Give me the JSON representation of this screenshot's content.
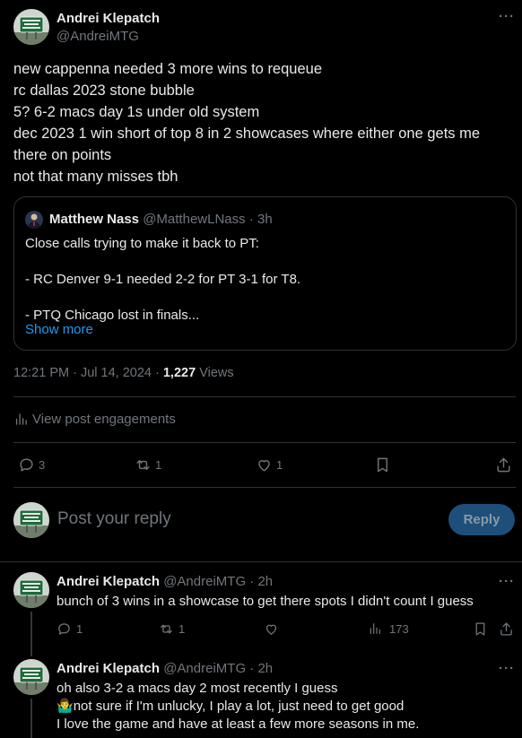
{
  "post": {
    "author_name": "Andrei Klepatch",
    "author_handle": "@AndreiMTG",
    "lines": [
      "new cappenna needed 3 more wins to requeue",
      "rc dallas 2023 stone bubble",
      "5? 6-2 macs day 1s under old system",
      "dec 2023 1 win short of top 8 in 2 showcases where either one gets me",
      "there on points",
      "not that many misses tbh"
    ],
    "quote": {
      "author_name": "Matthew Nass",
      "author_handle": "@MatthewLNass",
      "time": "· 3h",
      "lines": [
        "Close calls trying to make it back to PT:",
        "",
        "- RC Denver 9-1 needed 2-2 for PT 3-1 for T8.",
        "",
        "- PTQ Chicago lost in finals..."
      ],
      "show_more": "Show more"
    },
    "time": "12:21 PM · Jul 14, 2024 ·",
    "views_count": "1,227",
    "views_label": "Views",
    "engagements_label": "View post engagements",
    "replies": "3",
    "reposts": "1",
    "likes": "1"
  },
  "reply_box": {
    "placeholder": "Post your reply",
    "button": "Reply"
  },
  "replies": [
    {
      "author_name": "Andrei Klepatch",
      "author_handle": "@AndreiMTG",
      "time": "· 2h",
      "lines": [
        "bunch of 3 wins in a showcase to get there spots I didn't count I guess"
      ],
      "replies": "1",
      "reposts": "1",
      "views": "173"
    },
    {
      "author_name": "Andrei Klepatch",
      "author_handle": "@AndreiMTG",
      "time": "· 2h",
      "lines": [
        "oh also 3-2 a macs day 2 most recently I guess",
        "not sure if I'm unlucky, I play a lot, just need to get good",
        "I love the game and have at least a few more seasons in me."
      ],
      "emoji": "🤷‍♂️"
    }
  ],
  "colors": {
    "background": "#000000",
    "text": "#e7e9ea",
    "muted": "#71767b",
    "accent": "#1d9bf0",
    "divider": "#2f3336"
  },
  "icons": [
    "reply-icon",
    "repost-icon",
    "like-icon",
    "bookmark-icon",
    "share-icon",
    "analytics-icon",
    "more-icon"
  ]
}
